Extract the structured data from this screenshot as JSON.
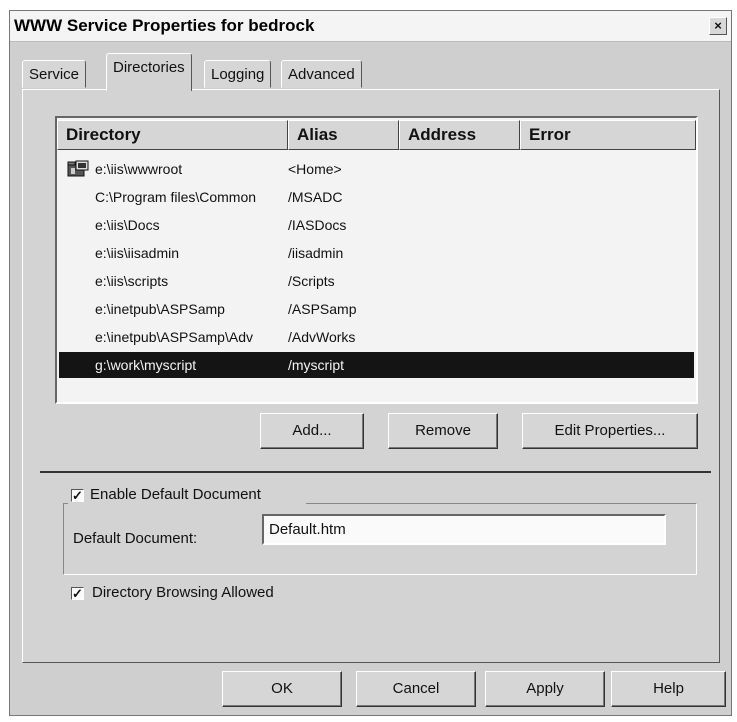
{
  "window": {
    "title": "WWW Service Properties for bedrock",
    "close_glyph": "×"
  },
  "tabs": [
    {
      "label": "Service"
    },
    {
      "label": "Directories"
    },
    {
      "label": "Logging"
    },
    {
      "label": "Advanced"
    }
  ],
  "list": {
    "columns": [
      "Directory",
      "Alias",
      "Address",
      "Error"
    ],
    "rows": [
      {
        "directory": "e:\\iis\\wwwroot",
        "alias": "<Home>"
      },
      {
        "directory": "C:\\Program files\\Common",
        "alias": "/MSADC"
      },
      {
        "directory": "e:\\iis\\Docs",
        "alias": "/IASDocs"
      },
      {
        "directory": "e:\\iis\\iisadmin",
        "alias": "/iisadmin"
      },
      {
        "directory": "e:\\iis\\scripts",
        "alias": "/Scripts"
      },
      {
        "directory": "e:\\inetpub\\ASPSamp",
        "alias": "/ASPSamp"
      },
      {
        "directory": "e:\\inetpub\\ASPSamp\\Adv",
        "alias": "/AdvWorks"
      },
      {
        "directory": "g:\\work\\myscript",
        "alias": "/myscript"
      }
    ],
    "selected_index": 7,
    "home_icon": "home-folder-icon"
  },
  "buttons": {
    "add": "Add...",
    "remove": "Remove",
    "edit": "Edit Properties..."
  },
  "default_doc": {
    "enable_label": "Enable Default Document",
    "enabled": true,
    "field_label": "Default Document:",
    "value": "Default.htm"
  },
  "browsing": {
    "label": "Directory Browsing Allowed",
    "enabled": true
  },
  "footer": {
    "ok": "OK",
    "cancel": "Cancel",
    "apply": "Apply",
    "help": "Help"
  },
  "check_glyph": "✓"
}
